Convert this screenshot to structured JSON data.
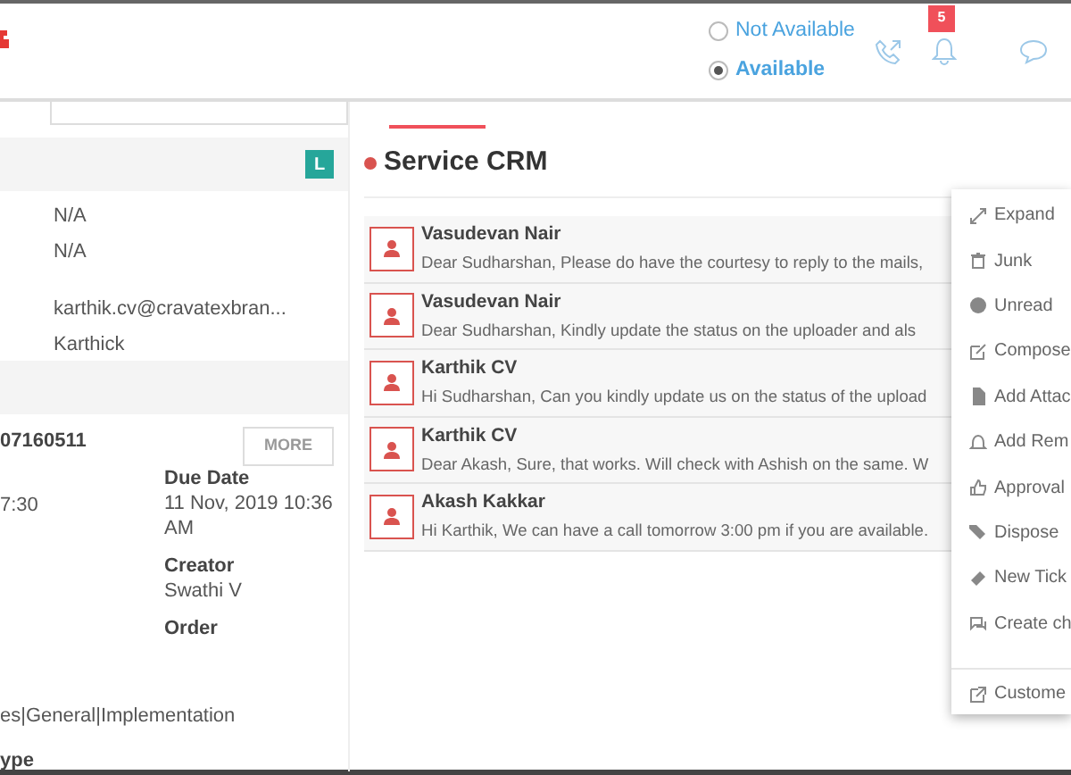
{
  "header": {
    "availability": [
      {
        "label": "Not Available",
        "selected": false
      },
      {
        "label": "Available",
        "selected": true
      }
    ],
    "notification_count": "5"
  },
  "contact_panel": {
    "badge": "L",
    "fields": [
      "N/A",
      "N/A",
      "karthik.cv@cravatexbran...",
      "Karthick"
    ]
  },
  "ticket_panel": {
    "ticket_number": "07160511",
    "more_button": "MORE",
    "time": "7:30",
    "due_date_label": "Due Date",
    "due_date": "11 Nov, 2019 10:36 AM",
    "creator_label": "Creator",
    "creator": "Swathi V",
    "order_label": "Order",
    "categories": "es|General|Implementation",
    "type_label": "ype"
  },
  "inbox": {
    "title": "Service CRM",
    "messages": [
      {
        "sender": "Vasudevan Nair",
        "preview": "Dear Sudharshan, Please do have the courtesy to reply to the mails,"
      },
      {
        "sender": "Vasudevan Nair",
        "preview": "Dear Sudharshan,  Kindly update the status on the uploader and als"
      },
      {
        "sender": "Karthik CV",
        "preview": "Hi Sudharshan, Can you kindly update us on the status of the upload"
      },
      {
        "sender": "Karthik CV",
        "preview": "Dear Akash, Sure, that works. Will check with Ashish on the same. W"
      },
      {
        "sender": "Akash Kakkar",
        "preview": "Hi Karthik, We can have a call tomorrow 3:00 pm if you are available."
      }
    ]
  },
  "context_menu": {
    "items": [
      "Expand",
      "Junk",
      "Unread",
      "Compose",
      "Add Attac",
      "Add Rem",
      "Approval",
      "Dispose",
      "New Tick",
      "Create ch"
    ],
    "footer_item": "Custome"
  }
}
